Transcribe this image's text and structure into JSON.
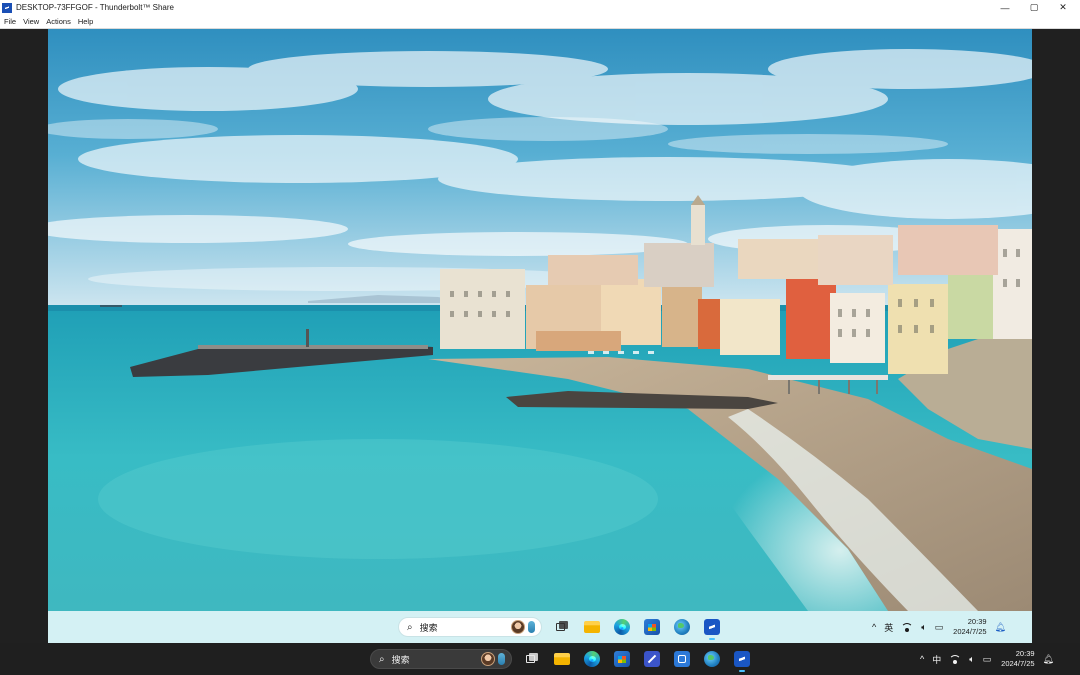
{
  "window": {
    "title": "DESKTOP-73FFGOF - Thunderbolt™ Share",
    "controls": {
      "minimize": "—",
      "maximize": "▢",
      "close": "✕"
    }
  },
  "menu": [
    "File",
    "View",
    "Actions",
    "Help"
  ],
  "remote_taskbar": {
    "search_placeholder": "搜索",
    "tray": {
      "chevron": "^",
      "ime": "英",
      "time": "20:39",
      "date": "2024/7/25"
    },
    "icons": [
      "start-icon",
      "task-view-icon",
      "file-explorer-icon",
      "edge-icon",
      "store-icon",
      "globe-app-icon",
      "thunderbolt-share-icon"
    ]
  },
  "host_taskbar": {
    "search_placeholder": "搜索",
    "tray": {
      "chevron": "^",
      "ime": "中",
      "time": "20:39",
      "date": "2024/7/25"
    },
    "icons": [
      "start-icon",
      "task-view-icon",
      "file-explorer-icon",
      "edge-icon",
      "store-icon",
      "pen-app-icon",
      "blue-app-icon",
      "globe-app-icon",
      "thunderbolt-share-icon"
    ]
  },
  "colors": {
    "remote_taskbar_bg": "#d4f1f4",
    "host_taskbar_bg": "#1f1f1f",
    "accent": "#1d8ce0"
  }
}
